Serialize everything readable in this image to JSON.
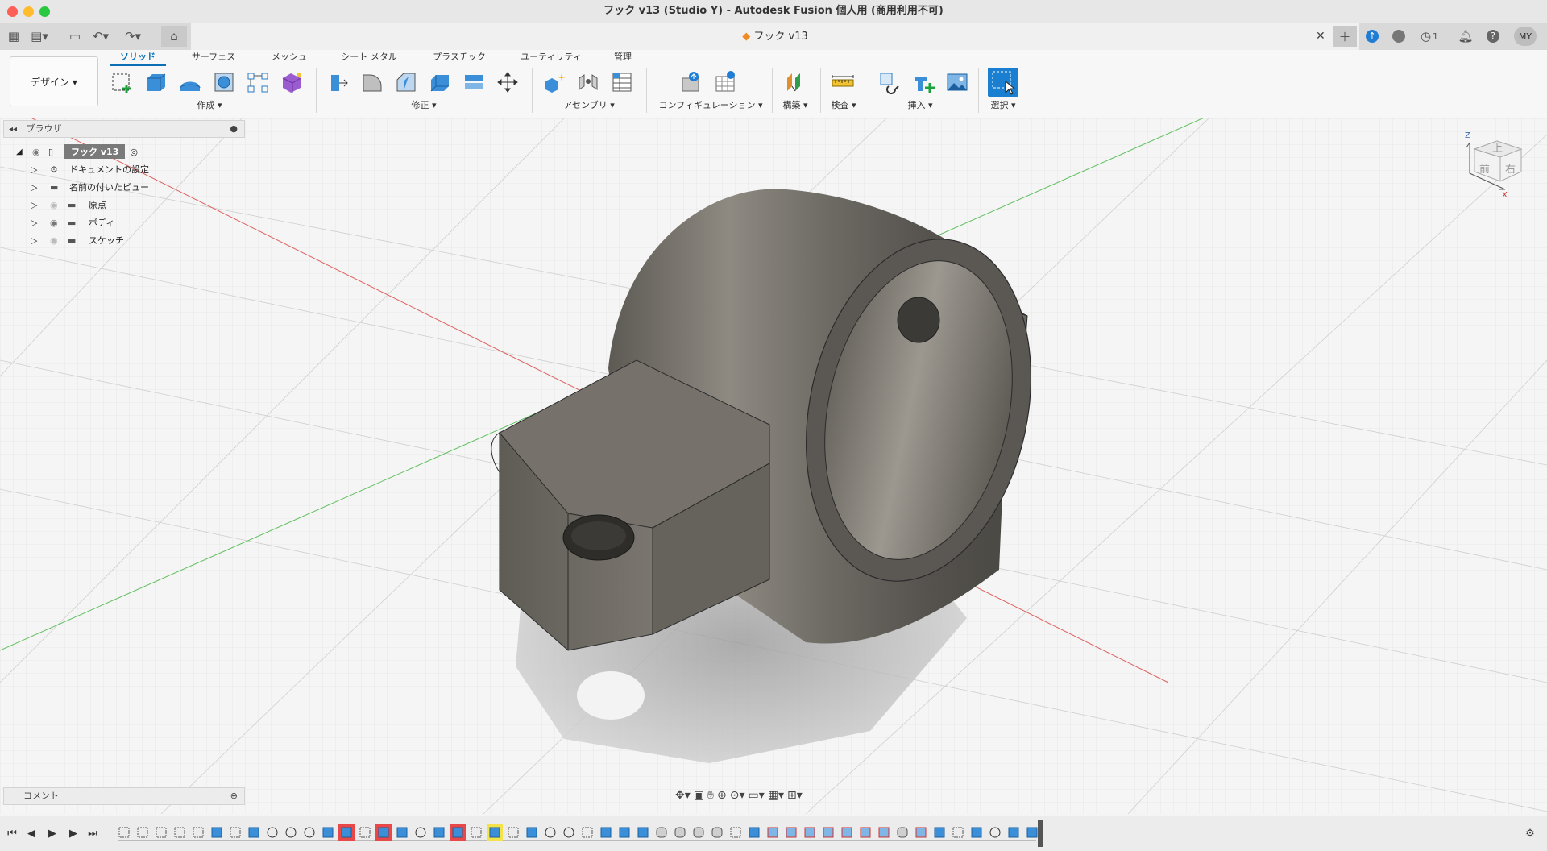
{
  "window": {
    "title": "フック v13 (Studio Y) - Autodesk Fusion 個人用 (商用利用不可)"
  },
  "tabbar": {
    "doc_title": "フック v13",
    "notification_count": "1",
    "user_initials": "MY"
  },
  "ribbon": {
    "workspace": "デザイン ▾",
    "tabs": [
      {
        "label": "ソリッド",
        "active": true
      },
      {
        "label": "サーフェス"
      },
      {
        "label": "メッシュ"
      },
      {
        "label": "シート メタル"
      },
      {
        "label": "プラスチック"
      },
      {
        "label": "ユーティリティ"
      },
      {
        "label": "管理"
      }
    ],
    "groups": {
      "create": "作成 ▾",
      "modify": "修正 ▾",
      "assembly": "アセンブリ ▾",
      "configuration": "コンフィギュレーション ▾",
      "construct": "構築 ▾",
      "inspect": "検査 ▾",
      "insert": "挿入 ▾",
      "select": "選択 ▾"
    }
  },
  "browser": {
    "title": "ブラウザ",
    "root": "フック v13",
    "items": [
      {
        "label": "ドキュメントの設定",
        "icon": "gear-icon"
      },
      {
        "label": "名前の付いたビュー",
        "icon": "folder-icon"
      },
      {
        "label": "原点",
        "icon": "folder-icon",
        "visibility": "hidden"
      },
      {
        "label": "ボディ",
        "icon": "folder-icon",
        "visibility": "visible"
      },
      {
        "label": "スケッチ",
        "icon": "folder-icon",
        "visibility": "hidden"
      }
    ]
  },
  "viewcube": {
    "top": "上",
    "front": "前",
    "right": "右",
    "axis_x": "X",
    "axis_z": "Z"
  },
  "comments": {
    "title": "コメント"
  },
  "colors": {
    "accent": "#0b6fb6",
    "model": "#7a766f",
    "grid_red": "#e06060",
    "grid_green": "#60c060",
    "highlight_red": "#e84848",
    "highlight_yellow": "#f3e24a"
  }
}
